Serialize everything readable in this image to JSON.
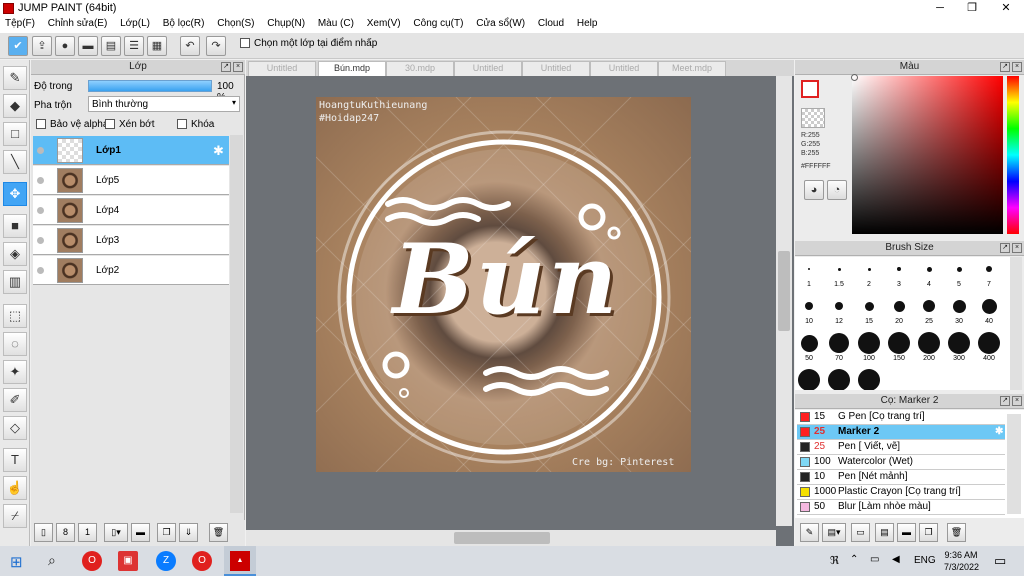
{
  "window": {
    "title": "JUMP PAINT (64bit)",
    "minimize": "─",
    "maximize": "❐",
    "close": "✕"
  },
  "menu": [
    "Tệp(F)",
    "Chỉnh sửa(E)",
    "Lớp(L)",
    "Bộ lọc(R)",
    "Chọn(S)",
    "Chụp(N)",
    "Màu (C)",
    "Xem(V)",
    "Công cụ(T)",
    "Cửa sổ(W)",
    "Cloud",
    "Help"
  ],
  "toolbar": {
    "option_label": "Chọn một lớp tại điểm nhấp"
  },
  "layer_panel": {
    "title": "Lớp",
    "opacity_label": "Độ trong",
    "opacity_value": "100 %",
    "blend_label": "Pha trộn",
    "blend_value": "Bình thường",
    "protect_alpha": "Bảo vệ alpha",
    "clip": "Xén bớt",
    "lock": "Khóa",
    "layers": [
      {
        "name": "Lớp1"
      },
      {
        "name": "Lớp5"
      },
      {
        "name": "Lớp4"
      },
      {
        "name": "Lớp3"
      },
      {
        "name": "Lớp2"
      }
    ]
  },
  "tabs": [
    "Untitled",
    "Bún.mdp",
    "30.mdp",
    "Untitled",
    "Untitled",
    "Untitled",
    "Meet.mdp"
  ],
  "canvas": {
    "watermark_line1": "HoangtuKuthieunang",
    "watermark_line2": "#Hoidap247",
    "main_text": "Bún",
    "credit": "Cre bg: Pinterest"
  },
  "color_panel": {
    "title": "Màu",
    "r": "R:255",
    "g": "G:255",
    "b": "B:255",
    "hex": "#FFFFFF"
  },
  "brush_size": {
    "title": "Brush Size",
    "sizes": [
      "1",
      "1.5",
      "2",
      "3",
      "4",
      "5",
      "7",
      "10",
      "12",
      "15",
      "20",
      "25",
      "30",
      "40",
      "50",
      "70",
      "100",
      "150",
      "200",
      "300",
      "400"
    ]
  },
  "brush_list": {
    "title": "Cọ: Marker 2",
    "items": [
      {
        "size": "15",
        "name": "G Pen [Cọ trang trí]",
        "color": "#ff2020"
      },
      {
        "size": "25",
        "name": "Marker 2",
        "color": "#ff2020"
      },
      {
        "size": "25",
        "name": "Pen [ Viết, vẽ]",
        "color": "#222222"
      },
      {
        "size": "100",
        "name": "Watercolor (Wet)",
        "color": "#7fd8f5"
      },
      {
        "size": "10",
        "name": "Pen [Nét mảnh]",
        "color": "#222222"
      },
      {
        "size": "1000",
        "name": "Plastic Crayon [Cọ trang trí]",
        "color": "#f5e000"
      },
      {
        "size": "50",
        "name": "Blur [Làm nhòe màu]",
        "color": "#f5b8e0"
      }
    ]
  },
  "taskbar": {
    "lang": "ENG",
    "time": "9:36 AM",
    "date": "7/3/2022"
  }
}
